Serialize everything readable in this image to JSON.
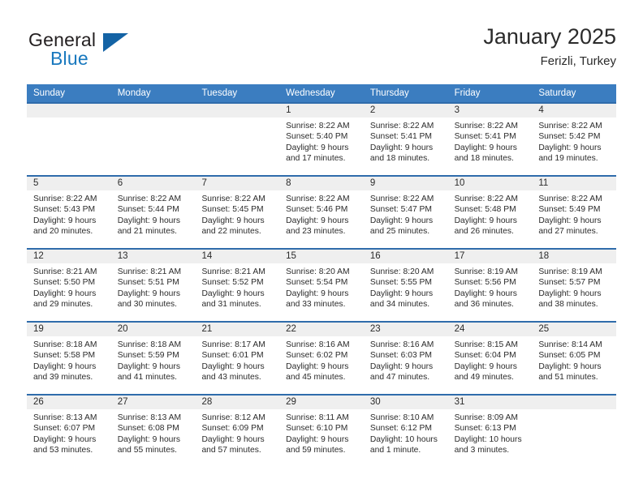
{
  "brand": {
    "word_one": "General",
    "word_two": "Blue",
    "triangle_icon": "triangle-icon"
  },
  "header": {
    "title": "January 2025",
    "subtitle": "Ferizli, Turkey"
  },
  "calendar": {
    "weekdays": [
      "Sunday",
      "Monday",
      "Tuesday",
      "Wednesday",
      "Thursday",
      "Friday",
      "Saturday"
    ],
    "colors": {
      "header_blue": "#3b7dc0",
      "cell_border_blue": "#2f6cab",
      "day_strip_gray": "#efefef",
      "logo_blue": "#1878be",
      "text": "#2b2b2b"
    },
    "weeks": [
      [
        {
          "day": "",
          "sunrise": "",
          "sunset": "",
          "daylight_line1": "",
          "daylight_line2": ""
        },
        {
          "day": "",
          "sunrise": "",
          "sunset": "",
          "daylight_line1": "",
          "daylight_line2": ""
        },
        {
          "day": "",
          "sunrise": "",
          "sunset": "",
          "daylight_line1": "",
          "daylight_line2": ""
        },
        {
          "day": "1",
          "sunrise": "Sunrise: 8:22 AM",
          "sunset": "Sunset: 5:40 PM",
          "daylight_line1": "Daylight: 9 hours",
          "daylight_line2": "and 17 minutes."
        },
        {
          "day": "2",
          "sunrise": "Sunrise: 8:22 AM",
          "sunset": "Sunset: 5:41 PM",
          "daylight_line1": "Daylight: 9 hours",
          "daylight_line2": "and 18 minutes."
        },
        {
          "day": "3",
          "sunrise": "Sunrise: 8:22 AM",
          "sunset": "Sunset: 5:41 PM",
          "daylight_line1": "Daylight: 9 hours",
          "daylight_line2": "and 18 minutes."
        },
        {
          "day": "4",
          "sunrise": "Sunrise: 8:22 AM",
          "sunset": "Sunset: 5:42 PM",
          "daylight_line1": "Daylight: 9 hours",
          "daylight_line2": "and 19 minutes."
        }
      ],
      [
        {
          "day": "5",
          "sunrise": "Sunrise: 8:22 AM",
          "sunset": "Sunset: 5:43 PM",
          "daylight_line1": "Daylight: 9 hours",
          "daylight_line2": "and 20 minutes."
        },
        {
          "day": "6",
          "sunrise": "Sunrise: 8:22 AM",
          "sunset": "Sunset: 5:44 PM",
          "daylight_line1": "Daylight: 9 hours",
          "daylight_line2": "and 21 minutes."
        },
        {
          "day": "7",
          "sunrise": "Sunrise: 8:22 AM",
          "sunset": "Sunset: 5:45 PM",
          "daylight_line1": "Daylight: 9 hours",
          "daylight_line2": "and 22 minutes."
        },
        {
          "day": "8",
          "sunrise": "Sunrise: 8:22 AM",
          "sunset": "Sunset: 5:46 PM",
          "daylight_line1": "Daylight: 9 hours",
          "daylight_line2": "and 23 minutes."
        },
        {
          "day": "9",
          "sunrise": "Sunrise: 8:22 AM",
          "sunset": "Sunset: 5:47 PM",
          "daylight_line1": "Daylight: 9 hours",
          "daylight_line2": "and 25 minutes."
        },
        {
          "day": "10",
          "sunrise": "Sunrise: 8:22 AM",
          "sunset": "Sunset: 5:48 PM",
          "daylight_line1": "Daylight: 9 hours",
          "daylight_line2": "and 26 minutes."
        },
        {
          "day": "11",
          "sunrise": "Sunrise: 8:22 AM",
          "sunset": "Sunset: 5:49 PM",
          "daylight_line1": "Daylight: 9 hours",
          "daylight_line2": "and 27 minutes."
        }
      ],
      [
        {
          "day": "12",
          "sunrise": "Sunrise: 8:21 AM",
          "sunset": "Sunset: 5:50 PM",
          "daylight_line1": "Daylight: 9 hours",
          "daylight_line2": "and 29 minutes."
        },
        {
          "day": "13",
          "sunrise": "Sunrise: 8:21 AM",
          "sunset": "Sunset: 5:51 PM",
          "daylight_line1": "Daylight: 9 hours",
          "daylight_line2": "and 30 minutes."
        },
        {
          "day": "14",
          "sunrise": "Sunrise: 8:21 AM",
          "sunset": "Sunset: 5:52 PM",
          "daylight_line1": "Daylight: 9 hours",
          "daylight_line2": "and 31 minutes."
        },
        {
          "day": "15",
          "sunrise": "Sunrise: 8:20 AM",
          "sunset": "Sunset: 5:54 PM",
          "daylight_line1": "Daylight: 9 hours",
          "daylight_line2": "and 33 minutes."
        },
        {
          "day": "16",
          "sunrise": "Sunrise: 8:20 AM",
          "sunset": "Sunset: 5:55 PM",
          "daylight_line1": "Daylight: 9 hours",
          "daylight_line2": "and 34 minutes."
        },
        {
          "day": "17",
          "sunrise": "Sunrise: 8:19 AM",
          "sunset": "Sunset: 5:56 PM",
          "daylight_line1": "Daylight: 9 hours",
          "daylight_line2": "and 36 minutes."
        },
        {
          "day": "18",
          "sunrise": "Sunrise: 8:19 AM",
          "sunset": "Sunset: 5:57 PM",
          "daylight_line1": "Daylight: 9 hours",
          "daylight_line2": "and 38 minutes."
        }
      ],
      [
        {
          "day": "19",
          "sunrise": "Sunrise: 8:18 AM",
          "sunset": "Sunset: 5:58 PM",
          "daylight_line1": "Daylight: 9 hours",
          "daylight_line2": "and 39 minutes."
        },
        {
          "day": "20",
          "sunrise": "Sunrise: 8:18 AM",
          "sunset": "Sunset: 5:59 PM",
          "daylight_line1": "Daylight: 9 hours",
          "daylight_line2": "and 41 minutes."
        },
        {
          "day": "21",
          "sunrise": "Sunrise: 8:17 AM",
          "sunset": "Sunset: 6:01 PM",
          "daylight_line1": "Daylight: 9 hours",
          "daylight_line2": "and 43 minutes."
        },
        {
          "day": "22",
          "sunrise": "Sunrise: 8:16 AM",
          "sunset": "Sunset: 6:02 PM",
          "daylight_line1": "Daylight: 9 hours",
          "daylight_line2": "and 45 minutes."
        },
        {
          "day": "23",
          "sunrise": "Sunrise: 8:16 AM",
          "sunset": "Sunset: 6:03 PM",
          "daylight_line1": "Daylight: 9 hours",
          "daylight_line2": "and 47 minutes."
        },
        {
          "day": "24",
          "sunrise": "Sunrise: 8:15 AM",
          "sunset": "Sunset: 6:04 PM",
          "daylight_line1": "Daylight: 9 hours",
          "daylight_line2": "and 49 minutes."
        },
        {
          "day": "25",
          "sunrise": "Sunrise: 8:14 AM",
          "sunset": "Sunset: 6:05 PM",
          "daylight_line1": "Daylight: 9 hours",
          "daylight_line2": "and 51 minutes."
        }
      ],
      [
        {
          "day": "26",
          "sunrise": "Sunrise: 8:13 AM",
          "sunset": "Sunset: 6:07 PM",
          "daylight_line1": "Daylight: 9 hours",
          "daylight_line2": "and 53 minutes."
        },
        {
          "day": "27",
          "sunrise": "Sunrise: 8:13 AM",
          "sunset": "Sunset: 6:08 PM",
          "daylight_line1": "Daylight: 9 hours",
          "daylight_line2": "and 55 minutes."
        },
        {
          "day": "28",
          "sunrise": "Sunrise: 8:12 AM",
          "sunset": "Sunset: 6:09 PM",
          "daylight_line1": "Daylight: 9 hours",
          "daylight_line2": "and 57 minutes."
        },
        {
          "day": "29",
          "sunrise": "Sunrise: 8:11 AM",
          "sunset": "Sunset: 6:10 PM",
          "daylight_line1": "Daylight: 9 hours",
          "daylight_line2": "and 59 minutes."
        },
        {
          "day": "30",
          "sunrise": "Sunrise: 8:10 AM",
          "sunset": "Sunset: 6:12 PM",
          "daylight_line1": "Daylight: 10 hours",
          "daylight_line2": "and 1 minute."
        },
        {
          "day": "31",
          "sunrise": "Sunrise: 8:09 AM",
          "sunset": "Sunset: 6:13 PM",
          "daylight_line1": "Daylight: 10 hours",
          "daylight_line2": "and 3 minutes."
        },
        {
          "day": "",
          "sunrise": "",
          "sunset": "",
          "daylight_line1": "",
          "daylight_line2": ""
        }
      ]
    ]
  }
}
